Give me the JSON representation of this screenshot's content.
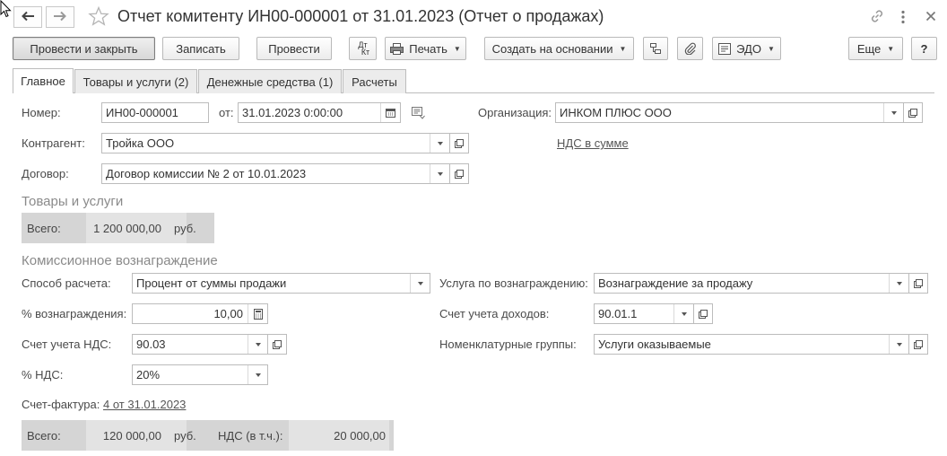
{
  "window": {
    "title": "Отчет комитенту ИН00-000001 от 31.01.2023 (Отчет о продажах)",
    "icons": [
      "back-arrow-icon",
      "forward-arrow-icon",
      "star-icon",
      "link-icon",
      "more-icon",
      "close-icon"
    ]
  },
  "toolbar": {
    "post_and_close": "Провести и закрыть",
    "save": "Записать",
    "post": "Провести",
    "dt_kt_top": "Дт",
    "dt_kt_bottom": "Кт",
    "print": "Печать",
    "create_based": "Создать на основании",
    "edo": "ЭДО",
    "more": "Еще",
    "help": "?"
  },
  "tabs": [
    {
      "label": "Главное",
      "active": true
    },
    {
      "label": "Товары и услуги (2)",
      "active": false
    },
    {
      "label": "Денежные средства (1)",
      "active": false
    },
    {
      "label": "Расчеты",
      "active": false
    }
  ],
  "header": {
    "number_label": "Номер:",
    "number_value": "ИН00-000001",
    "date_label": "от:",
    "date_value": "31.01.2023  0:00:00",
    "org_label": "Организация:",
    "org_value": "ИНКОМ ПЛЮС ООО",
    "counterparty_label": "Контрагент:",
    "counterparty_value": "Тройка ООО",
    "vat_link": "НДС в сумме",
    "contract_label": "Договор:",
    "contract_value": "Договор комиссии № 2 от 10.01.2023"
  },
  "goods": {
    "section_title": "Товары и услуги",
    "total_label": "Всего:",
    "total_value": "1 200 000,00",
    "currency": "руб."
  },
  "commission": {
    "section_title": "Комиссионное вознаграждение",
    "calc_method_label": "Способ расчета:",
    "calc_method_value": "Процент от суммы продажи",
    "service_label": "Услуга по вознаграждению:",
    "service_value": "Вознаграждение за продажу",
    "percent_label": "% вознаграждения:",
    "percent_value": "10,00",
    "income_account_label": "Счет учета доходов:",
    "income_account_value": "90.01.1",
    "vat_account_label": "Счет учета НДС:",
    "vat_account_value": "90.03",
    "nom_groups_label": "Номенклатурные группы:",
    "nom_groups_value": "Услуги оказываемые",
    "vat_rate_label": "% НДС:",
    "vat_rate_value": "20%",
    "invoice_label": "Счет-фактура:",
    "invoice_link": "4 от 31.01.2023",
    "total_label": "Всего:",
    "total_value": "120 000,00",
    "currency": "руб.",
    "vat_incl_label": "НДС (в т.ч.):",
    "vat_incl_value": "20 000,00"
  }
}
